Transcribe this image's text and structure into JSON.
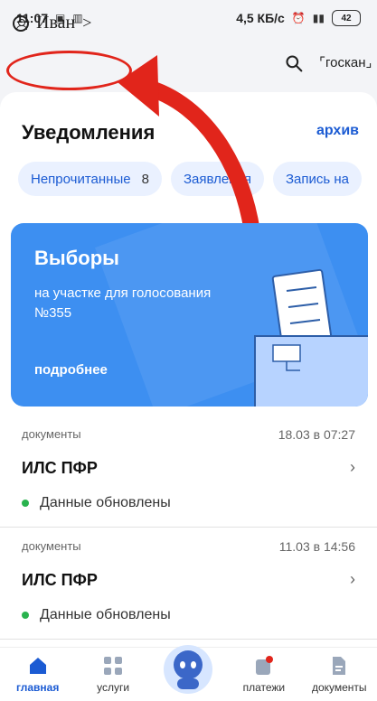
{
  "statusbar": {
    "time": "11:07",
    "network": "4,5 КБ/с",
    "battery": "42"
  },
  "profile": {
    "name": "Иван",
    "chevron": ">"
  },
  "header": {
    "gos_button": "госкан"
  },
  "notifications": {
    "title": "Уведомления",
    "archive": "архив"
  },
  "chips": [
    {
      "label": "Непрочитанные",
      "count": "8"
    },
    {
      "label": "Заявления",
      "count": ""
    },
    {
      "label": "Запись на",
      "count": ""
    }
  ],
  "banner": {
    "title": "Выборы",
    "text_line1": "на участке для голосования",
    "text_line2": "№355",
    "more": "подробнее"
  },
  "documents": [
    {
      "category": "документы",
      "date": "18.03 в 07:27",
      "title": "ИЛС ПФР",
      "status": "Данные обновлены"
    },
    {
      "category": "документы",
      "date": "11.03 в 14:56",
      "title": "ИЛС ПФР",
      "status": "Данные обновлены"
    }
  ],
  "bottom_nav": [
    {
      "label": "главная",
      "icon": "home-icon",
      "active": true
    },
    {
      "label": "услуги",
      "icon": "grid-icon",
      "active": false
    },
    {
      "label": "",
      "icon": "robot-icon",
      "active": false
    },
    {
      "label": "платежи",
      "icon": "payments-icon",
      "active": false
    },
    {
      "label": "документы",
      "icon": "documents-icon",
      "active": false
    }
  ],
  "colors": {
    "accent": "#1b5bd3",
    "banner": "#3d8ff1",
    "highlight": "#e1251b",
    "success": "#29b34e"
  }
}
